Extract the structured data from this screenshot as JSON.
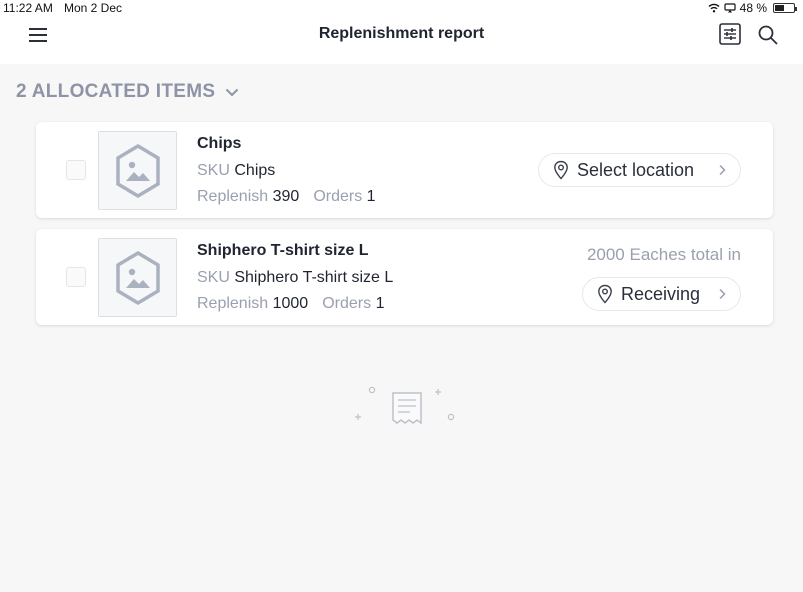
{
  "status_bar": {
    "time": "11:22 AM",
    "date": "Mon 2 Dec",
    "battery": "48 %",
    "battery_level": 0.48
  },
  "header": {
    "title": "Replenishment report",
    "icons": [
      "menu-icon",
      "filter-icon",
      "search-icon"
    ]
  },
  "section": {
    "title": "2 ALLOCATED ITEMS",
    "icon": "chevron-down-icon"
  },
  "labels": {
    "sku": "SKU",
    "replenish": "Replenish",
    "orders": "Orders"
  },
  "items": [
    {
      "name": "Chips",
      "sku": "Chips",
      "replenish": "390",
      "orders": "1",
      "location": "Select location",
      "total": ""
    },
    {
      "name": "Shiphero T-shirt size L",
      "sku": "Shiphero T-shirt size L",
      "replenish": "1000",
      "orders": "1",
      "location": "Receiving",
      "total": "2000 Eaches total in"
    }
  ],
  "colors": {
    "background": "#f7f7f8",
    "muted_text": "#9aa0b0",
    "section_title": "#8e94a6",
    "primary_text": "#1f2430"
  }
}
